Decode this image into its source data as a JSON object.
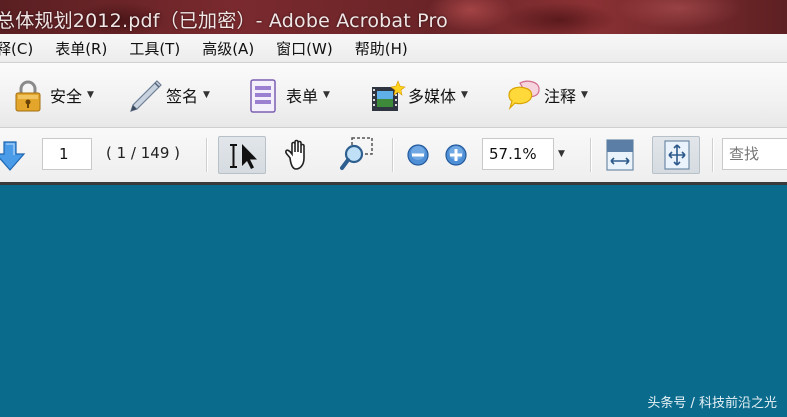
{
  "window": {
    "title": "总体规划2012.pdf（已加密）- Adobe Acrobat Pro"
  },
  "menu": {
    "items": [
      "释(C)",
      "表单(R)",
      "工具(T)",
      "高级(A)",
      "窗口(W)",
      "帮助(H)"
    ]
  },
  "toolbar": {
    "security_label": "安全",
    "sign_label": "签名",
    "forms_label": "表单",
    "multimedia_label": "多媒体",
    "comment_label": "注释"
  },
  "navigation": {
    "page_number": "1",
    "page_count": "( 1 / 149 )",
    "zoom_value": "57.1%",
    "search_placeholder": "查找"
  },
  "watermark": {
    "text": "头条号 / 科技前沿之光"
  },
  "colors": {
    "document_background": "#0a6b8c",
    "title_bar": "#6e2629"
  }
}
